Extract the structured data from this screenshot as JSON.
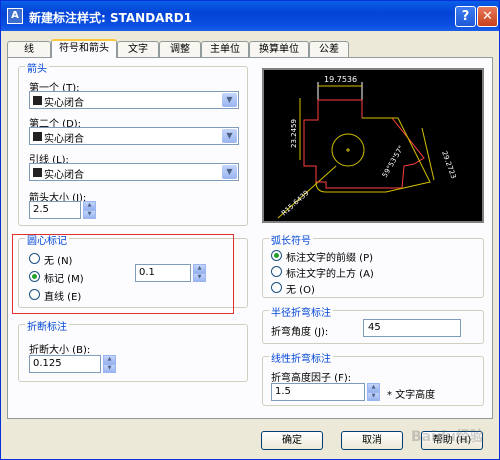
{
  "window": {
    "title": "新建标注样式: STANDARD1",
    "icon": "autocad-dimension-icon"
  },
  "tabs": [
    "线",
    "符号和箭头",
    "文字",
    "调整",
    "主单位",
    "换算单位",
    "公差"
  ],
  "arrows": {
    "group_title": "箭头",
    "first_label": "第一个 (T):",
    "first_value": "实心闭合",
    "second_label": "第二个 (D):",
    "second_value": "实心闭合",
    "leader_label": "引线 (L):",
    "leader_value": "实心闭合",
    "size_label": "箭头大小 (I):",
    "size_value": "2.5"
  },
  "center_marks": {
    "group_title": "圆心标记",
    "options": [
      "无 (N)",
      "标记 (M)",
      "直线 (E)"
    ],
    "selected": "标记 (M)",
    "size_value": "0.1"
  },
  "break": {
    "group_title": "折断标注",
    "size_label": "折断大小 (B):",
    "size_value": "0.125"
  },
  "arc_length": {
    "group_title": "弧长符号",
    "options": [
      "标注文字的前缀 (P)",
      "标注文字的上方 (A)",
      "无 (O)"
    ],
    "selected": "标注文字的前缀 (P)"
  },
  "radius_jog": {
    "group_title": "半径折弯标注",
    "angle_label": "折弯角度 (J):",
    "angle_value": "45"
  },
  "linear_jog": {
    "group_title": "线性折弯标注",
    "factor_label": "折弯高度因子 (F):",
    "factor_value": "1.5",
    "suffix": "* 文字高度"
  },
  "preview": {
    "dims": [
      "19.7536",
      "23.2459",
      "29.2723",
      "59°53'57\"",
      "R15.6439"
    ]
  },
  "buttons": {
    "ok": "确定",
    "cancel": "取消",
    "help": "帮助 (H)"
  },
  "watermark": "Baidu经验"
}
